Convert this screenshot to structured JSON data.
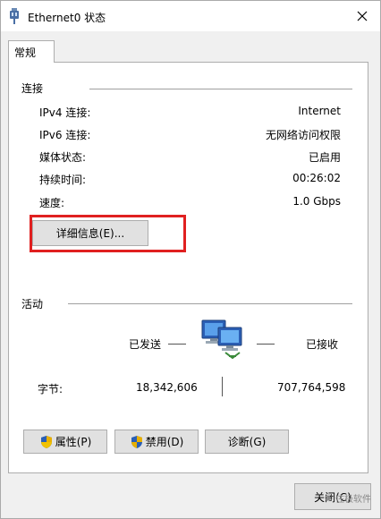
{
  "window": {
    "title": "Ethernet0 状态"
  },
  "tab": {
    "label": "常规"
  },
  "connection": {
    "group_label": "连接",
    "rows": [
      {
        "label": "IPv4 连接:",
        "value": "Internet"
      },
      {
        "label": "IPv6 连接:",
        "value": "无网络访问权限"
      },
      {
        "label": "媒体状态:",
        "value": "已启用"
      },
      {
        "label": "持续时间:",
        "value": "00:26:02"
      },
      {
        "label": "速度:",
        "value": "1.0 Gbps"
      }
    ],
    "details_button": "详细信息(E)..."
  },
  "activity": {
    "group_label": "活动",
    "sent_label": "已发送",
    "received_label": "已接收",
    "bytes_label": "字节:",
    "bytes_sent": "18,342,606",
    "bytes_received": "707,764,598"
  },
  "buttons": {
    "properties": "属性(P)",
    "disable": "禁用(D)",
    "diagnose": "诊断(G)",
    "close": "关闭(C)"
  },
  "watermark": {
    "text": "住极软件"
  },
  "colors": {
    "highlight": "#e02020",
    "button_bg": "#e1e1e1"
  }
}
